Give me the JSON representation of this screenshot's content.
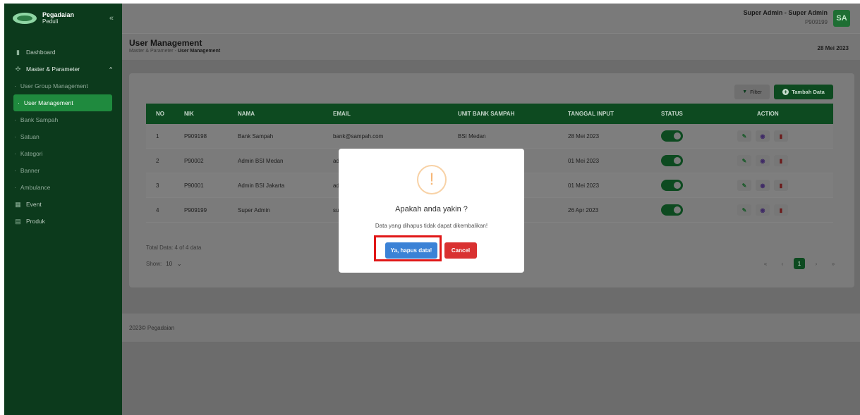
{
  "brand": {
    "title": "Pegadaian",
    "subtitle": "Peduli",
    "collapse_icon": "«"
  },
  "sidebar": {
    "dashboard": "Dashboard",
    "master": "Master & Parameter",
    "sub_items": [
      "User Group Management",
      "User Management",
      "Bank Sampah",
      "Satuan",
      "Kategori",
      "Banner",
      "Ambulance"
    ],
    "event": "Event",
    "produk": "Produk"
  },
  "user": {
    "name": "Super Admin - Super Admin",
    "id": "P909199",
    "initials": "SA"
  },
  "page": {
    "title": "User Management",
    "breadcrumb_root": "Master & Parameter",
    "breadcrumb_sep": "-",
    "breadcrumb_current": "User Management",
    "date": "28 Mei 2023"
  },
  "toolbar": {
    "filter_label": "Filter",
    "add_label": "Tambah Data"
  },
  "table": {
    "headers": [
      "NO",
      "NIK",
      "NAMA",
      "EMAIL",
      "UNIT BANK SAMPAH",
      "TANGGAL INPUT",
      "STATUS",
      "ACTION"
    ],
    "rows": [
      {
        "no": "1",
        "nik": "P909198",
        "nama": "Bank Sampah",
        "email": "bank@sampah.com",
        "unit": "BSI Medan",
        "tanggal": "28 Mei 2023"
      },
      {
        "no": "2",
        "nik": "P90002",
        "nama": "Admin BSI Medan",
        "email": "ad",
        "unit": "",
        "tanggal": "01 Mei 2023"
      },
      {
        "no": "3",
        "nik": "P90001",
        "nama": "Admin BSI Jakarta",
        "email": "ad",
        "unit": "",
        "tanggal": "01 Mei 2023"
      },
      {
        "no": "4",
        "nik": "P909199",
        "nama": "Super Admin",
        "email": "su",
        "unit": "",
        "tanggal": "26 Apr 2023"
      }
    ]
  },
  "summary": {
    "total": "Total Data: 4 of 4 data",
    "show_label": "Show:",
    "show_value": "10"
  },
  "pagination": {
    "first": "«",
    "prev": "‹",
    "current": "1",
    "next": "›",
    "last": "»"
  },
  "footer": {
    "text": "2023© Pegadaian"
  },
  "modal": {
    "icon": "!",
    "title": "Apakah anda yakin ?",
    "text": "Data yang dihapus tidak dapat dikembalikan!",
    "confirm": "Ya, hapus data!",
    "cancel": "Cancel"
  }
}
